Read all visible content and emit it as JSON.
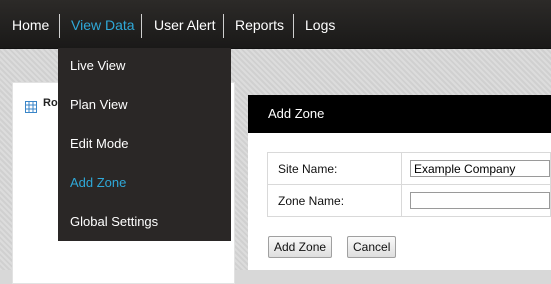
{
  "nav": {
    "items": [
      {
        "label": "Home"
      },
      {
        "label": "View Data"
      },
      {
        "label": "User Alert"
      },
      {
        "label": "Reports"
      },
      {
        "label": "Logs"
      }
    ],
    "active_color": "#2fa8d8"
  },
  "dropdown": {
    "items": [
      {
        "label": "Live View"
      },
      {
        "label": "Plan View"
      },
      {
        "label": "Edit Mode"
      },
      {
        "label": "Add Zone"
      },
      {
        "label": "Global Settings"
      }
    ],
    "active_item": "Add Zone"
  },
  "tree": {
    "icon": "grid-icon",
    "root_label": "Ro"
  },
  "add_zone": {
    "title": "Add Zone",
    "site_name_label": "Site Name:",
    "site_name_value": "Example Company",
    "zone_name_label": "Zone Name:",
    "zone_name_value": "",
    "add_button": "Add Zone",
    "cancel_button": "Cancel"
  }
}
